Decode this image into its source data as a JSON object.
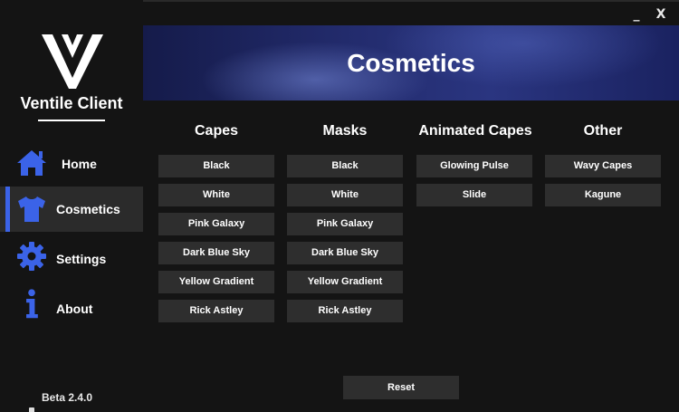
{
  "window": {
    "minimize_label": "_",
    "close_label": "X"
  },
  "sidebar": {
    "brand": "Ventile Client",
    "items": [
      {
        "label": "Home",
        "icon": "home-icon"
      },
      {
        "label": "Cosmetics",
        "icon": "shirt-icon",
        "active": true
      },
      {
        "label": "Settings",
        "icon": "gear-icon"
      },
      {
        "label": "About",
        "icon": "info-icon"
      }
    ],
    "version": "Beta 2.4.0"
  },
  "header": {
    "title": "Cosmetics"
  },
  "columns": [
    {
      "title": "Capes",
      "options": [
        "Black",
        "White",
        "Pink Galaxy",
        "Dark Blue Sky",
        "Yellow Gradient",
        "Rick Astley"
      ]
    },
    {
      "title": "Masks",
      "options": [
        "Black",
        "White",
        "Pink Galaxy",
        "Dark Blue Sky",
        "Yellow Gradient",
        "Rick Astley"
      ]
    },
    {
      "title": "Animated Capes",
      "options": [
        "Glowing Pulse",
        "Slide"
      ]
    },
    {
      "title": "Other",
      "options": [
        "Wavy Capes",
        "Kagune"
      ]
    }
  ],
  "footer": {
    "reset_label": "Reset"
  },
  "colors": {
    "accent": "#3b63e8",
    "background": "#141414",
    "button": "#2e2e2e"
  }
}
